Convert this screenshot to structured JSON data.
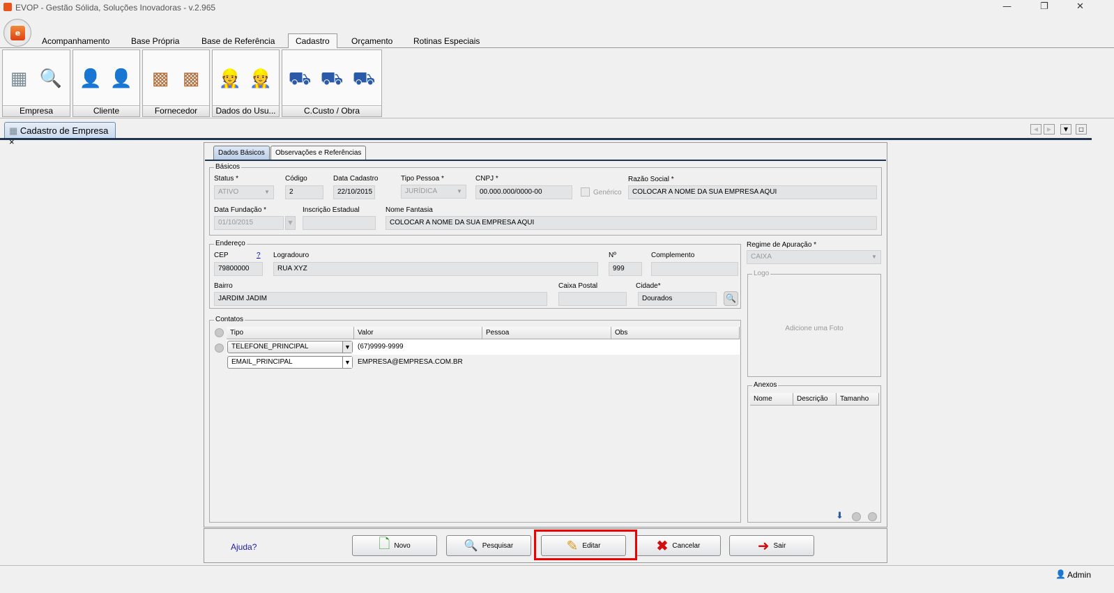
{
  "window": {
    "title": "EVOP - Gestão Sólida, Soluções Inovadoras - v.2.965",
    "logo": "EVOP"
  },
  "ribbon_tabs": [
    "Acompanhamento",
    "Base Própria",
    "Base de Referência",
    "Cadastro",
    "Orçamento",
    "Rotinas Especiais"
  ],
  "ribbon_active": "Cadastro",
  "groups": [
    {
      "label": "Empresa",
      "icons": [
        "building-add-icon",
        "building-search-icon"
      ]
    },
    {
      "label": "Cliente",
      "icons": [
        "client-add-icon",
        "client-search-icon"
      ]
    },
    {
      "label": "Fornecedor",
      "icons": [
        "supplier-add-icon",
        "supplier-search-icon"
      ]
    },
    {
      "label": "Dados do Usu...",
      "icons": [
        "worker-add-icon",
        "worker-search-icon"
      ]
    },
    {
      "label": "C.Custo / Obra",
      "icons": [
        "wheelbarrow-add-icon",
        "wheelbarrow-search-icon",
        "wheelbarrow-remove-icon"
      ]
    }
  ],
  "doc_tab": {
    "label": "Cadastro de Empresa",
    "close": "×"
  },
  "form_tabs": [
    "Dados Básicos",
    "Observações e Referências"
  ],
  "basicos": {
    "legend": "Básicos",
    "status_label": "Status  *",
    "status": "ATIVO",
    "codigo_label": "Código",
    "codigo": "2",
    "data_cadastro_label": "Data Cadastro",
    "data_cadastro": "22/10/2015",
    "tipo_label": "Tipo Pessoa  *",
    "tipo": "JURÍDICA",
    "cnpj_label": "CNPJ *",
    "cnpj": "00.000.000/0000-00",
    "generico_label": "Genérico",
    "razao_label": "Razão Social *",
    "razao": "COLOCAR A NOME DA SUA EMPRESA AQUI",
    "fundacao_label": "Data Fundação *",
    "fundacao": "01/10/2015",
    "ie_label": "Inscrição Estadual",
    "ie": "",
    "fantasia_label": "Nome Fantasia",
    "fantasia": "COLOCAR A NOME DA SUA EMPRESA AQUI"
  },
  "endereco": {
    "legend": "Endereço",
    "cep_label": "CEP",
    "cep_help": "?",
    "cep": "79800000",
    "logradouro_label": "Logradouro",
    "logradouro": "RUA XYZ",
    "numero_label": "Nº",
    "numero": "999",
    "complemento_label": "Complemento",
    "complemento": "",
    "bairro_label": "Bairro",
    "bairro": "JARDIM JADIM",
    "caixa_label": "Caixa Postal",
    "caixa": "",
    "cidade_label": "Cidade*",
    "cidade": "Dourados"
  },
  "regime": {
    "label": "Regime de Apuração *",
    "value": "CAIXA"
  },
  "logo_box": {
    "legend": "Logo",
    "placeholder": "Adicione uma Foto"
  },
  "anexos": {
    "legend": "Anexos",
    "columns": [
      "Nome",
      "Descrição",
      "Tamanho"
    ]
  },
  "contatos": {
    "legend": "Contatos",
    "columns": [
      "Tipo",
      "Valor",
      "Pessoa",
      "Obs"
    ],
    "rows": [
      {
        "tipo": "TELEFONE_PRINCIPAL",
        "valor": "(67)9999-9999",
        "pessoa": "",
        "obs": ""
      },
      {
        "tipo": "EMAIL_PRINCIPAL",
        "valor": "EMPRESA@EMPRESA.COM.BR",
        "pessoa": "",
        "obs": ""
      }
    ]
  },
  "footer": {
    "help": "Ajuda?",
    "buttons": [
      "Novo",
      "Pesquisar",
      "Editar",
      "Cancelar",
      "Sair"
    ],
    "highlighted": "Editar"
  },
  "status": {
    "user": "Admin"
  },
  "colors": {
    "highlight": "#ee0000",
    "tab_dark": "#1f3450",
    "link": "#0000cc"
  }
}
